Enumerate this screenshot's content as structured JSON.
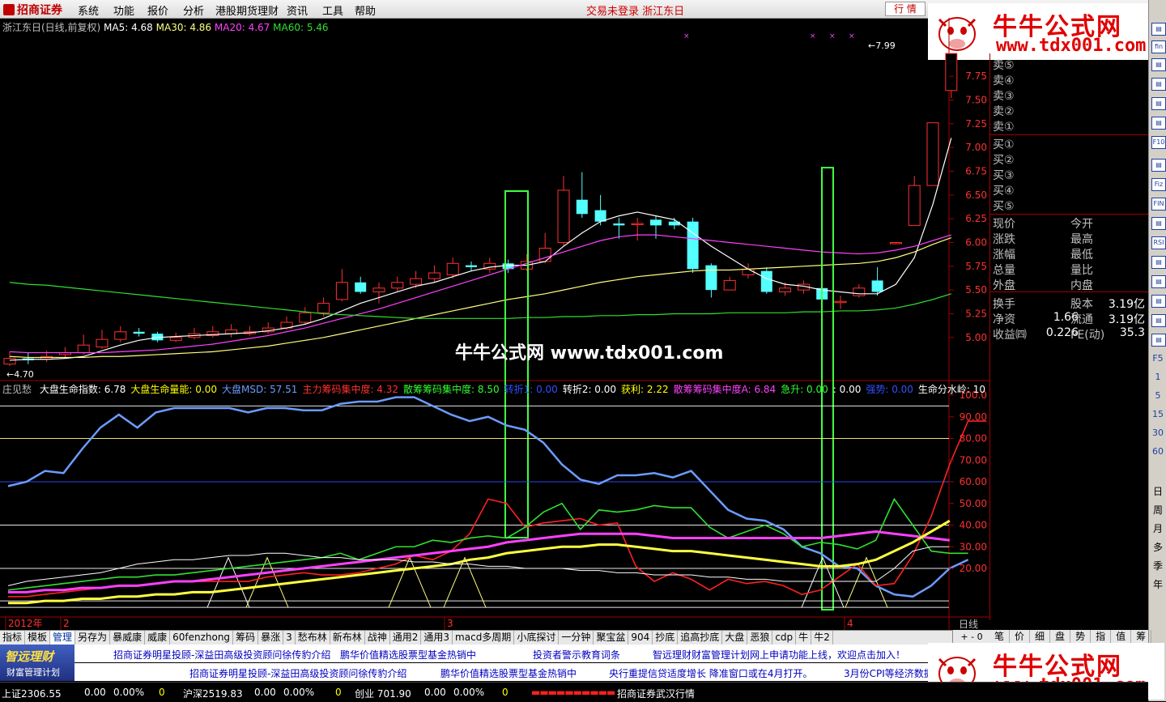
{
  "menu": {
    "logo": "招商证券",
    "items": [
      "系统",
      "功能",
      "报价",
      "分析",
      "港股期货理财",
      "资讯",
      "工具",
      "帮助"
    ],
    "status_msg": "交易未登录  浙江东日",
    "quote_button": "行 情"
  },
  "watermark": {
    "title": "牛牛公式网",
    "url": "www.tdx001.com",
    "center_text": "牛牛公式网 www.tdx001.com"
  },
  "main_legend": {
    "stock": "浙江东日(日线,前复权)",
    "ma5": "MA5: 4.68",
    "ma30": "MA30: 4.86",
    "ma20": "MA20: 4.67",
    "ma60": "MA60: 5.46"
  },
  "indicator_legend": {
    "name": "庄见愁",
    "items": [
      {
        "text": "大盘生命指数: 6.78",
        "color": "#ffffff"
      },
      {
        "text": "大盘生命量能: 0.00",
        "color": "#ffff00"
      },
      {
        "text": "大盘MSD: 57.51",
        "color": "#6c9cff"
      },
      {
        "text": "主力筹码集中度: 4.32",
        "color": "#ff3030"
      },
      {
        "text": "散筹筹码集中度: 8.50",
        "color": "#30ff30"
      },
      {
        "text": "转折1: 0.00",
        "color": "#3050ff"
      },
      {
        "text": "转折2: 0.00",
        "color": "#ffffff"
      },
      {
        "text": "获利: 2.22",
        "color": "#ffff00"
      },
      {
        "text": "散筹筹码集中度A: 6.84",
        "color": "#ff40ff"
      },
      {
        "text": "急升: 0.00",
        "color": "#30ff30"
      },
      {
        "text": ": 0.00",
        "color": "#ffffff"
      },
      {
        "text": "强势: 0.00",
        "color": "#3050ff"
      },
      {
        "text": "生命分水岭: 10",
        "color": "#ffffff"
      }
    ]
  },
  "chart_data": [
    {
      "type": "candlestick",
      "title": "浙江东日(日线,前复权)",
      "y_ticks": [
        "7.75",
        "7.50",
        "7.25",
        "7.00",
        "6.75",
        "6.50",
        "6.25",
        "6.00",
        "5.75",
        "5.50",
        "5.25",
        "5.00"
      ],
      "ylim": [
        4.5,
        8.2
      ],
      "annotations": {
        "low": "4.70",
        "high": "7.99"
      },
      "x_labels": [
        "2012年",
        "2",
        "3",
        "4"
      ],
      "candles": [
        {
          "o": 4.72,
          "c": 4.78,
          "h": 4.85,
          "l": 4.7
        },
        {
          "o": 4.78,
          "c": 4.76,
          "h": 4.84,
          "l": 4.72
        },
        {
          "o": 4.77,
          "c": 4.8,
          "h": 4.86,
          "l": 4.74
        },
        {
          "o": 4.82,
          "c": 4.84,
          "h": 4.9,
          "l": 4.78
        },
        {
          "o": 4.84,
          "c": 4.92,
          "h": 5.03,
          "l": 4.82
        },
        {
          "o": 4.9,
          "c": 4.98,
          "h": 5.08,
          "l": 4.88
        },
        {
          "o": 4.98,
          "c": 5.06,
          "h": 5.12,
          "l": 4.95
        },
        {
          "o": 5.06,
          "c": 5.04,
          "h": 5.1,
          "l": 5.01
        },
        {
          "o": 5.04,
          "c": 4.97,
          "h": 5.06,
          "l": 4.95
        },
        {
          "o": 4.97,
          "c": 5.0,
          "h": 5.05,
          "l": 4.95
        },
        {
          "o": 5.0,
          "c": 5.04,
          "h": 5.1,
          "l": 4.98
        },
        {
          "o": 5.02,
          "c": 5.06,
          "h": 5.12,
          "l": 5.0
        },
        {
          "o": 5.04,
          "c": 5.08,
          "h": 5.14,
          "l": 5.0
        },
        {
          "o": 5.04,
          "c": 5.06,
          "h": 5.12,
          "l": 5.02
        },
        {
          "o": 5.06,
          "c": 5.1,
          "h": 5.16,
          "l": 5.04
        },
        {
          "o": 5.1,
          "c": 5.16,
          "h": 5.22,
          "l": 5.08
        },
        {
          "o": 5.16,
          "c": 5.26,
          "h": 5.32,
          "l": 5.14
        },
        {
          "o": 5.26,
          "c": 5.36,
          "h": 5.42,
          "l": 5.22
        },
        {
          "o": 5.4,
          "c": 5.58,
          "h": 5.72,
          "l": 5.38
        },
        {
          "o": 5.58,
          "c": 5.48,
          "h": 5.64,
          "l": 5.46
        },
        {
          "o": 5.48,
          "c": 5.52,
          "h": 5.58,
          "l": 5.36
        },
        {
          "o": 5.52,
          "c": 5.58,
          "h": 5.64,
          "l": 5.48
        },
        {
          "o": 5.56,
          "c": 5.62,
          "h": 5.7,
          "l": 5.52
        },
        {
          "o": 5.62,
          "c": 5.68,
          "h": 5.76,
          "l": 5.58
        },
        {
          "o": 5.66,
          "c": 5.78,
          "h": 5.84,
          "l": 5.62
        },
        {
          "o": 5.76,
          "c": 5.74,
          "h": 5.8,
          "l": 5.7
        },
        {
          "o": 5.72,
          "c": 5.78,
          "h": 5.84,
          "l": 5.68
        },
        {
          "o": 5.78,
          "c": 5.72,
          "h": 5.82,
          "l": 5.68
        },
        {
          "o": 5.72,
          "c": 5.8,
          "h": 5.88,
          "l": 5.7
        },
        {
          "o": 5.8,
          "c": 5.94,
          "h": 6.1,
          "l": 5.78
        },
        {
          "o": 6.0,
          "c": 6.55,
          "h": 6.7,
          "l": 5.96
        },
        {
          "o": 6.45,
          "c": 6.3,
          "h": 6.74,
          "l": 6.26
        },
        {
          "o": 6.34,
          "c": 6.22,
          "h": 6.5,
          "l": 6.18
        },
        {
          "o": 6.2,
          "c": 6.18,
          "h": 6.26,
          "l": 6.04
        },
        {
          "o": 6.2,
          "c": 6.2,
          "h": 6.26,
          "l": 6.02
        },
        {
          "o": 6.24,
          "c": 6.18,
          "h": 6.28,
          "l": 6.04
        },
        {
          "o": 6.22,
          "c": 6.18,
          "h": 6.26,
          "l": 6.14
        },
        {
          "o": 6.22,
          "c": 5.72,
          "h": 6.26,
          "l": 5.68
        },
        {
          "o": 5.76,
          "c": 5.5,
          "h": 5.78,
          "l": 5.42
        },
        {
          "o": 5.5,
          "c": 5.6,
          "h": 5.64,
          "l": 5.5
        },
        {
          "o": 5.66,
          "c": 5.72,
          "h": 5.78,
          "l": 5.62
        },
        {
          "o": 5.7,
          "c": 5.48,
          "h": 5.74,
          "l": 5.46
        },
        {
          "o": 5.48,
          "c": 5.52,
          "h": 5.58,
          "l": 5.44
        },
        {
          "o": 5.5,
          "c": 5.56,
          "h": 5.6,
          "l": 5.46
        },
        {
          "o": 5.52,
          "c": 5.4,
          "h": 5.54,
          "l": 5.36
        },
        {
          "o": 5.38,
          "c": 5.38,
          "h": 5.44,
          "l": 5.3
        },
        {
          "o": 5.44,
          "c": 5.52,
          "h": 5.56,
          "l": 5.42
        },
        {
          "o": 5.6,
          "c": 5.48,
          "h": 5.74,
          "l": 5.44
        },
        {
          "o": 6.0,
          "c": 6.0,
          "h": 6.0,
          "l": 6.0
        },
        {
          "o": 6.18,
          "c": 6.6,
          "h": 6.7,
          "l": 6.18
        },
        {
          "o": 6.6,
          "c": 7.26,
          "h": 7.26,
          "l": 6.6
        },
        {
          "o": 7.6,
          "c": 7.99,
          "h": 7.99,
          "l": 7.52
        }
      ],
      "series": [
        {
          "name": "MA5",
          "values": [
            4.76,
            4.77,
            4.77,
            4.78,
            4.8,
            4.86,
            4.92,
            4.97,
            5.0,
            5.01,
            5.02,
            5.03,
            5.04,
            5.05,
            5.07,
            5.1,
            5.14,
            5.2,
            5.28,
            5.36,
            5.42,
            5.48,
            5.54,
            5.58,
            5.64,
            5.7,
            5.74,
            5.76,
            5.76,
            5.8,
            5.96,
            6.1,
            6.22,
            6.28,
            6.32,
            6.28,
            6.24,
            6.1,
            5.96,
            5.84,
            5.72,
            5.62,
            5.56,
            5.54,
            5.5,
            5.48,
            5.46,
            5.46,
            5.56,
            5.84,
            6.4,
            7.1
          ]
        },
        {
          "name": "MA30",
          "values": [
            4.8,
            4.79,
            4.79,
            4.79,
            4.79,
            4.8,
            4.8,
            4.81,
            4.82,
            4.83,
            4.84,
            4.85,
            4.87,
            4.89,
            4.91,
            4.94,
            4.97,
            5.0,
            5.04,
            5.08,
            5.12,
            5.16,
            5.2,
            5.24,
            5.28,
            5.32,
            5.36,
            5.4,
            5.43,
            5.46,
            5.5,
            5.54,
            5.58,
            5.61,
            5.64,
            5.66,
            5.68,
            5.7,
            5.71,
            5.71,
            5.72,
            5.73,
            5.74,
            5.75,
            5.76,
            5.77,
            5.78,
            5.8,
            5.84,
            5.9,
            5.98,
            6.05
          ]
        },
        {
          "name": "MA20",
          "values": [
            4.85,
            4.84,
            4.84,
            4.84,
            4.84,
            4.84,
            4.85,
            4.86,
            4.87,
            4.89,
            4.91,
            4.93,
            4.96,
            4.99,
            5.02,
            5.06,
            5.1,
            5.15,
            5.2,
            5.25,
            5.3,
            5.36,
            5.42,
            5.48,
            5.54,
            5.6,
            5.66,
            5.72,
            5.78,
            5.84,
            5.9,
            5.96,
            6.02,
            6.06,
            6.08,
            6.08,
            6.06,
            6.04,
            6.02,
            6.0,
            5.98,
            5.96,
            5.94,
            5.92,
            5.9,
            5.89,
            5.88,
            5.89,
            5.92,
            5.96,
            6.02,
            6.08
          ]
        },
        {
          "name": "MA60",
          "values": [
            5.58,
            5.56,
            5.55,
            5.53,
            5.51,
            5.49,
            5.47,
            5.45,
            5.43,
            5.41,
            5.39,
            5.37,
            5.35,
            5.33,
            5.31,
            5.29,
            5.27,
            5.25,
            5.24,
            5.23,
            5.22,
            5.21,
            5.2,
            5.2,
            5.2,
            5.2,
            5.2,
            5.2,
            5.21,
            5.21,
            5.22,
            5.22,
            5.23,
            5.23,
            5.24,
            5.24,
            5.25,
            5.25,
            5.25,
            5.26,
            5.26,
            5.26,
            5.26,
            5.27,
            5.27,
            5.28,
            5.28,
            5.29,
            5.31,
            5.35,
            5.4,
            5.46
          ]
        }
      ]
    },
    {
      "type": "line",
      "title": "庄见愁",
      "y_ticks": [
        "100.0",
        "90.00",
        "80.00",
        "70.00",
        "60.00",
        "50.00",
        "40.00",
        "30.00",
        "20.00"
      ],
      "ylim": [
        0,
        105
      ],
      "series": [
        {
          "name": "大盘MSD",
          "values": [
            58,
            60,
            65,
            64,
            75,
            85,
            91,
            85,
            92,
            94,
            94,
            94,
            94,
            92,
            94,
            94,
            93,
            93,
            96,
            97,
            97,
            99,
            99,
            95,
            91,
            88,
            90,
            86,
            84,
            78,
            68,
            61,
            59,
            63,
            63,
            64,
            62,
            65,
            56,
            47,
            43,
            42,
            38,
            30,
            27,
            21,
            20,
            12,
            8,
            7,
            12,
            20,
            24
          ]
        },
        {
          "name": "主力筹码集中度",
          "values": [
            7,
            7,
            8,
            9,
            10,
            11,
            12,
            12,
            13,
            14,
            14,
            14,
            14,
            14,
            16,
            17,
            18,
            17,
            17,
            18,
            20,
            22,
            26,
            24,
            28,
            36,
            52,
            50,
            39,
            41,
            42,
            43,
            40,
            41,
            21,
            14,
            18,
            15,
            10,
            15,
            13,
            14,
            12,
            8,
            10,
            16,
            22,
            12,
            13,
            26,
            44,
            68,
            88,
            88
          ]
        },
        {
          "name": "散筹筹码集中度",
          "values": [
            10,
            11,
            12,
            13,
            14,
            15,
            16,
            16,
            17,
            17,
            18,
            19,
            20,
            21,
            22,
            23,
            24,
            25,
            27,
            24,
            27,
            30,
            30,
            33,
            32,
            34,
            35,
            34,
            39,
            46,
            50,
            38,
            47,
            46,
            47,
            49,
            48,
            48,
            39,
            34,
            37,
            40,
            36,
            30,
            32,
            31,
            29,
            33,
            52,
            40,
            28,
            27,
            27
          ]
        },
        {
          "name": "散筹筹码集中度A",
          "values": [
            9,
            9,
            10,
            10,
            11,
            11,
            12,
            12,
            13,
            14,
            14,
            15,
            16,
            17,
            18,
            19,
            20,
            21,
            22,
            23,
            24,
            25,
            26,
            27,
            28,
            29,
            30,
            32,
            33,
            34,
            35,
            36,
            36,
            36,
            36,
            35,
            34,
            34,
            34,
            34,
            34,
            34,
            34,
            34,
            34,
            35,
            36,
            37,
            36,
            35,
            34,
            33
          ]
        },
        {
          "name": "获利",
          "values": [
            4,
            4,
            5,
            5,
            6,
            6,
            7,
            7,
            8,
            8,
            9,
            9,
            10,
            11,
            12,
            13,
            14,
            15,
            16,
            17,
            18,
            19,
            20,
            21,
            22,
            24,
            25,
            27,
            28,
            29,
            30,
            30,
            31,
            31,
            30,
            29,
            28,
            28,
            27,
            26,
            25,
            24,
            23,
            22,
            21,
            21,
            22,
            24,
            28,
            32,
            37,
            42
          ]
        },
        {
          "name": "大盘生命指数",
          "values": [
            12,
            14,
            15,
            16,
            17,
            18,
            20,
            22,
            23,
            24,
            24,
            25,
            26,
            26,
            27,
            27,
            26,
            25,
            25,
            24,
            24,
            24,
            23,
            23,
            22,
            22,
            21,
            21,
            20,
            20,
            20,
            19,
            19,
            18,
            18,
            17,
            17,
            17,
            16,
            16,
            15,
            15,
            14,
            14,
            14,
            14,
            14,
            14,
            20,
            28,
            30,
            30
          ]
        }
      ]
    }
  ],
  "right_panel": {
    "sell": [
      "卖⑤",
      "卖④",
      "卖③",
      "卖②",
      "卖①"
    ],
    "buy": [
      "买①",
      "买②",
      "买③",
      "买④",
      "买⑤"
    ],
    "rows": [
      {
        "l": "现价",
        "m": "",
        "r": "今开",
        "v": ""
      },
      {
        "l": "涨跌",
        "m": "",
        "r": "最高",
        "v": ""
      },
      {
        "l": "涨幅",
        "m": "",
        "r": "最低",
        "v": ""
      },
      {
        "l": "总量",
        "m": "",
        "r": "量比",
        "v": ""
      },
      {
        "l": "外盘",
        "m": "",
        "r": "内盘",
        "v": ""
      },
      {
        "l": "换手",
        "m": "",
        "r": "股本",
        "v": "3.19亿"
      },
      {
        "l": "净资",
        "m": "1.66",
        "r": "流通",
        "v": "3.19亿"
      },
      {
        "l": "收益㈣",
        "m": "0.226",
        "r": "PE(动)",
        "v": "35.3"
      }
    ]
  },
  "right_toolbar": {
    "icons": [
      "fin",
      "RSI",
      "F10",
      "Fiz",
      "FIN"
    ],
    "nums": [
      "F5",
      "1",
      "5",
      "15",
      "30",
      "60"
    ],
    "periods": [
      "日",
      "周",
      "月",
      "多",
      "季",
      "年"
    ]
  },
  "tabs": [
    "指标",
    "模板",
    "管理",
    "另存为",
    "暴威康",
    "威康",
    "60fenzhong",
    "筹码",
    "暴涨",
    "3",
    "愁布林",
    "新布林",
    "战神",
    "通用2",
    "通用3",
    "macd多周期",
    "小底探讨",
    "一分钟",
    "聚宝盆",
    "904",
    "抄底",
    "追高抄底",
    "大盘",
    "恶狼",
    "cdp",
    "牛",
    "牛2"
  ],
  "period_label": "日线",
  "bottom_tabs": [
    "笔",
    "价",
    "细",
    "盘",
    "势",
    "指",
    "值",
    "筹"
  ],
  "news": {
    "ad_title": "智远理财",
    "ad_sub": "财富管理计划",
    "line1": [
      "招商证券明星投顾-深益田高级投资顾问徐传豹介绍",
      "鹏华价值精选股票型基金热销中",
      "投资者警示教育词条",
      "智远理财财富管理计划网上申请功能上线，欢迎点击加入！"
    ],
    "line2": [
      "招商证券明星投顾-深益田高级投资顾问徐传豹介绍",
      "鹏华价值精选股票型基金热销中",
      "央行重提信贷适度增长  降准窗口或在4月打开。",
      "3月份CPI等经济数据"
    ]
  },
  "statusbar": {
    "sh": "上证2306.55",
    "sh_chg": "0.00",
    "sh_pct": "0.00%",
    "sh_vol": "0",
    "hs": "沪深2519.83",
    "hs_chg": "0.00",
    "hs_pct": "0.00%",
    "hs_vol": "0",
    "cy": "创业  701.90",
    "cy_chg": "0.00",
    "cy_pct": "0.00%",
    "cy_vol": "0",
    "broker": "招商证券武汉行情"
  },
  "colors": {
    "up": "#ff3030",
    "down": "#54ffff",
    "ma5": "#ffffff",
    "ma30": "#ffff80",
    "ma20": "#ff40ff",
    "ma60": "#30e030",
    "grid": "#a00000",
    "box": "#40ff40"
  }
}
